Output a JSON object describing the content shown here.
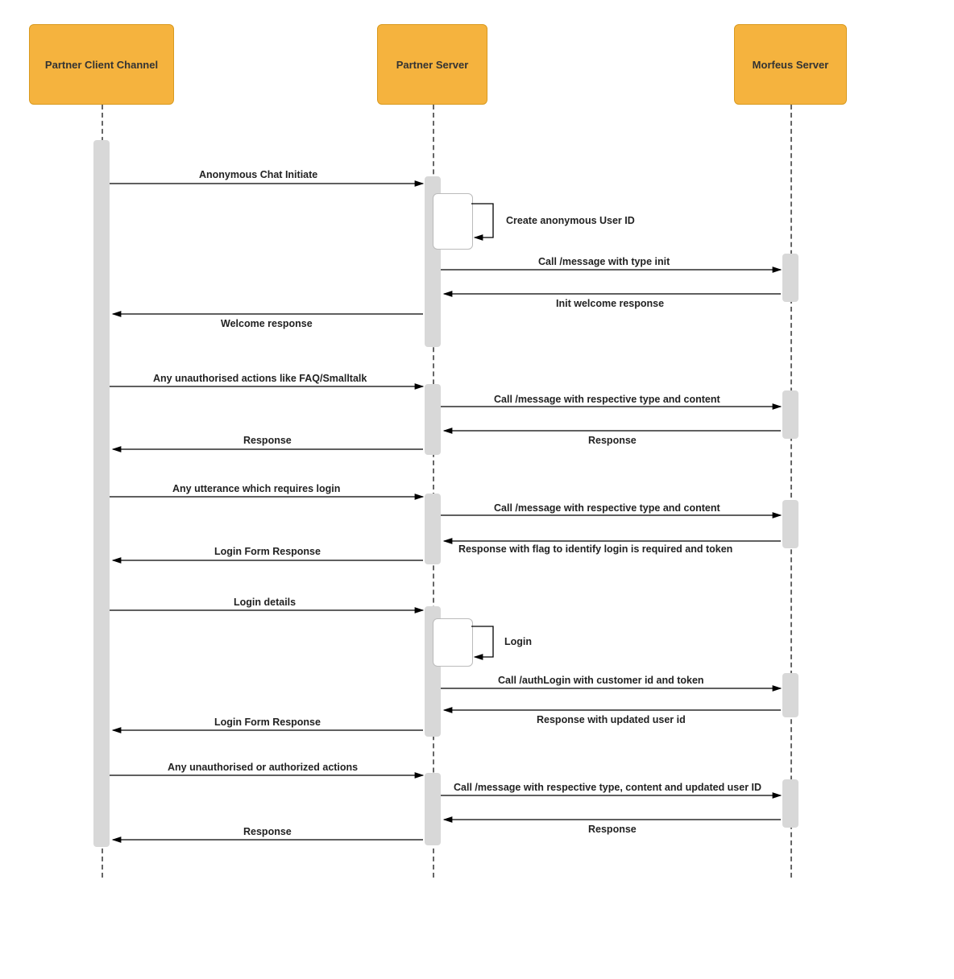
{
  "participants": {
    "client": "Partner Client Channel",
    "partner": "Partner Server",
    "morfeus": "Morfeus Server"
  },
  "messages": {
    "m1": "Anonymous Chat Initiate",
    "m2": "Create anonymous User ID",
    "m3": "Call /message with type init",
    "m4": "Init welcome response",
    "m5": "Welcome response",
    "m6": "Any unauthorised actions like FAQ/Smalltalk",
    "m7": "Call /message with respective type and content",
    "m8": "Response",
    "m9": "Response",
    "m10": "Any utterance which requires login",
    "m11": "Call /message with respective type and content",
    "m12": "Response with flag to identify login is required and token",
    "m13": "Login Form Response",
    "m14": "Login details",
    "m15": "Login",
    "m16": "Call /authLogin with customer id and token",
    "m17": "Response with updated user id",
    "m18": "Login Form Response",
    "m19": "Any unauthorised or authorized actions",
    "m20": "Call /message with respective type, content and updated user ID",
    "m21": "Response",
    "m22": "Response"
  }
}
